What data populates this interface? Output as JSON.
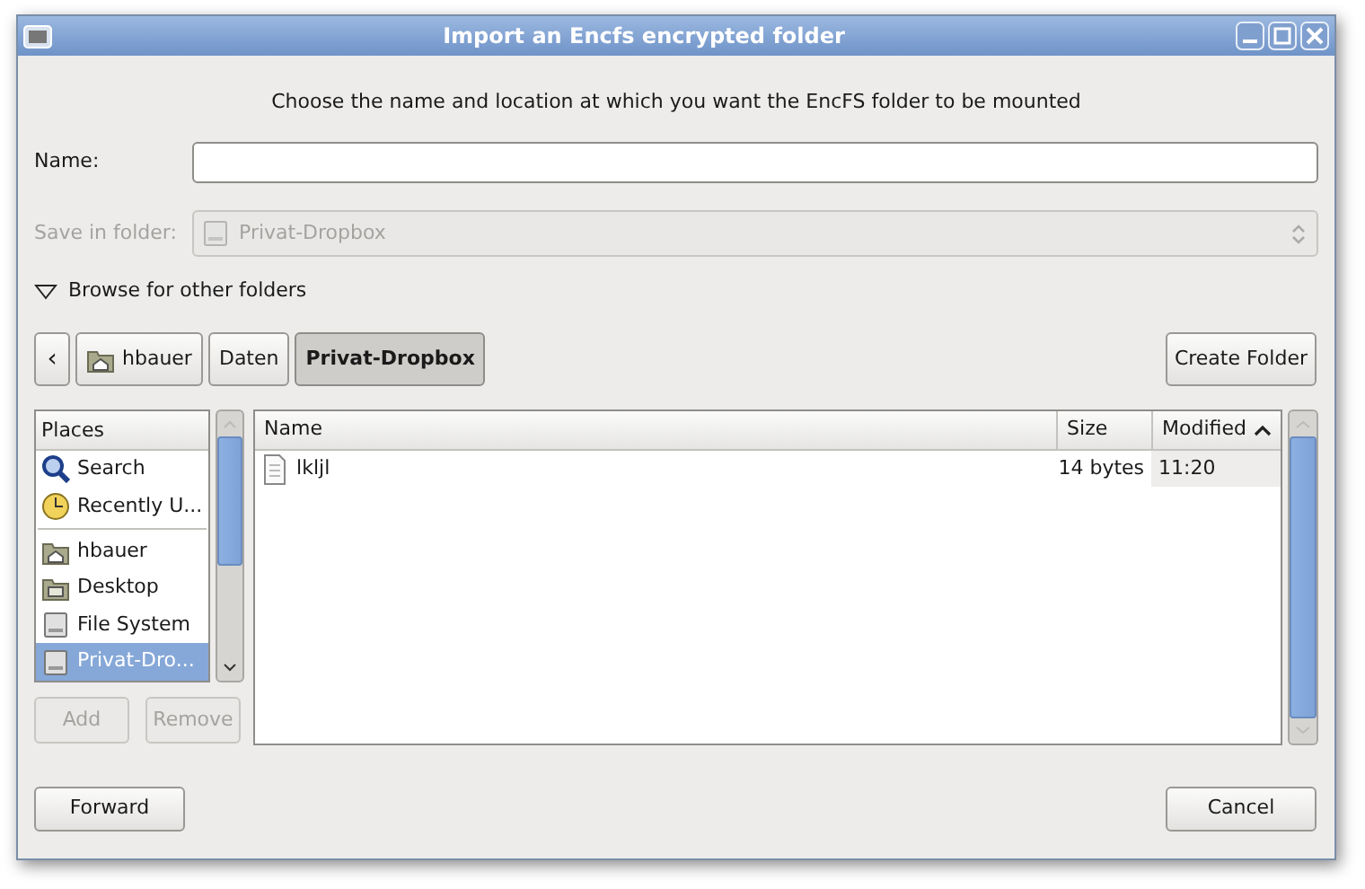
{
  "window": {
    "title": "Import an Encfs encrypted folder"
  },
  "message": "Choose the name and location at which you want the EncFS folder to be mounted",
  "name_field": {
    "label": "Name:"
  },
  "save_in_folder": {
    "label": "Save in folder:",
    "value": "Privat-Dropbox",
    "disabled": true
  },
  "browse": {
    "label": "Browse for other folders",
    "expanded": true
  },
  "path_bar": {
    "back": "‹",
    "items": [
      {
        "label": "hbauer",
        "kind": "home",
        "selected": false
      },
      {
        "label": "Daten",
        "kind": "plain",
        "selected": false
      },
      {
        "label": "Privat-Dropbox",
        "kind": "plain",
        "selected": true
      }
    ]
  },
  "create_folder": "Create Folder",
  "places": {
    "heading": "Places",
    "groups": [
      [
        {
          "label": "Search",
          "kind": "search",
          "selected": false
        },
        {
          "label": "Recently U...",
          "kind": "recent",
          "selected": false
        }
      ],
      [
        {
          "label": "hbauer",
          "kind": "home",
          "selected": false
        },
        {
          "label": "Desktop",
          "kind": "desktop",
          "selected": false
        },
        {
          "label": "File System",
          "kind": "drive",
          "selected": false
        },
        {
          "label": "Privat-Dro...",
          "kind": "drive",
          "selected": true
        }
      ]
    ]
  },
  "places_buttons": [
    {
      "label": "Add",
      "disabled": true
    },
    {
      "label": "Remove",
      "disabled": true
    }
  ],
  "files": {
    "columns": [
      {
        "label": "Name",
        "sorted": false
      },
      {
        "label": "Size",
        "sorted": false
      },
      {
        "label": "Modified",
        "sorted": true
      }
    ],
    "rows": [
      {
        "name": "lkljl",
        "size": "14 bytes",
        "modified": "11:20"
      }
    ]
  },
  "buttons": [
    {
      "label": "Forward"
    },
    {
      "label": "Cancel"
    }
  ]
}
